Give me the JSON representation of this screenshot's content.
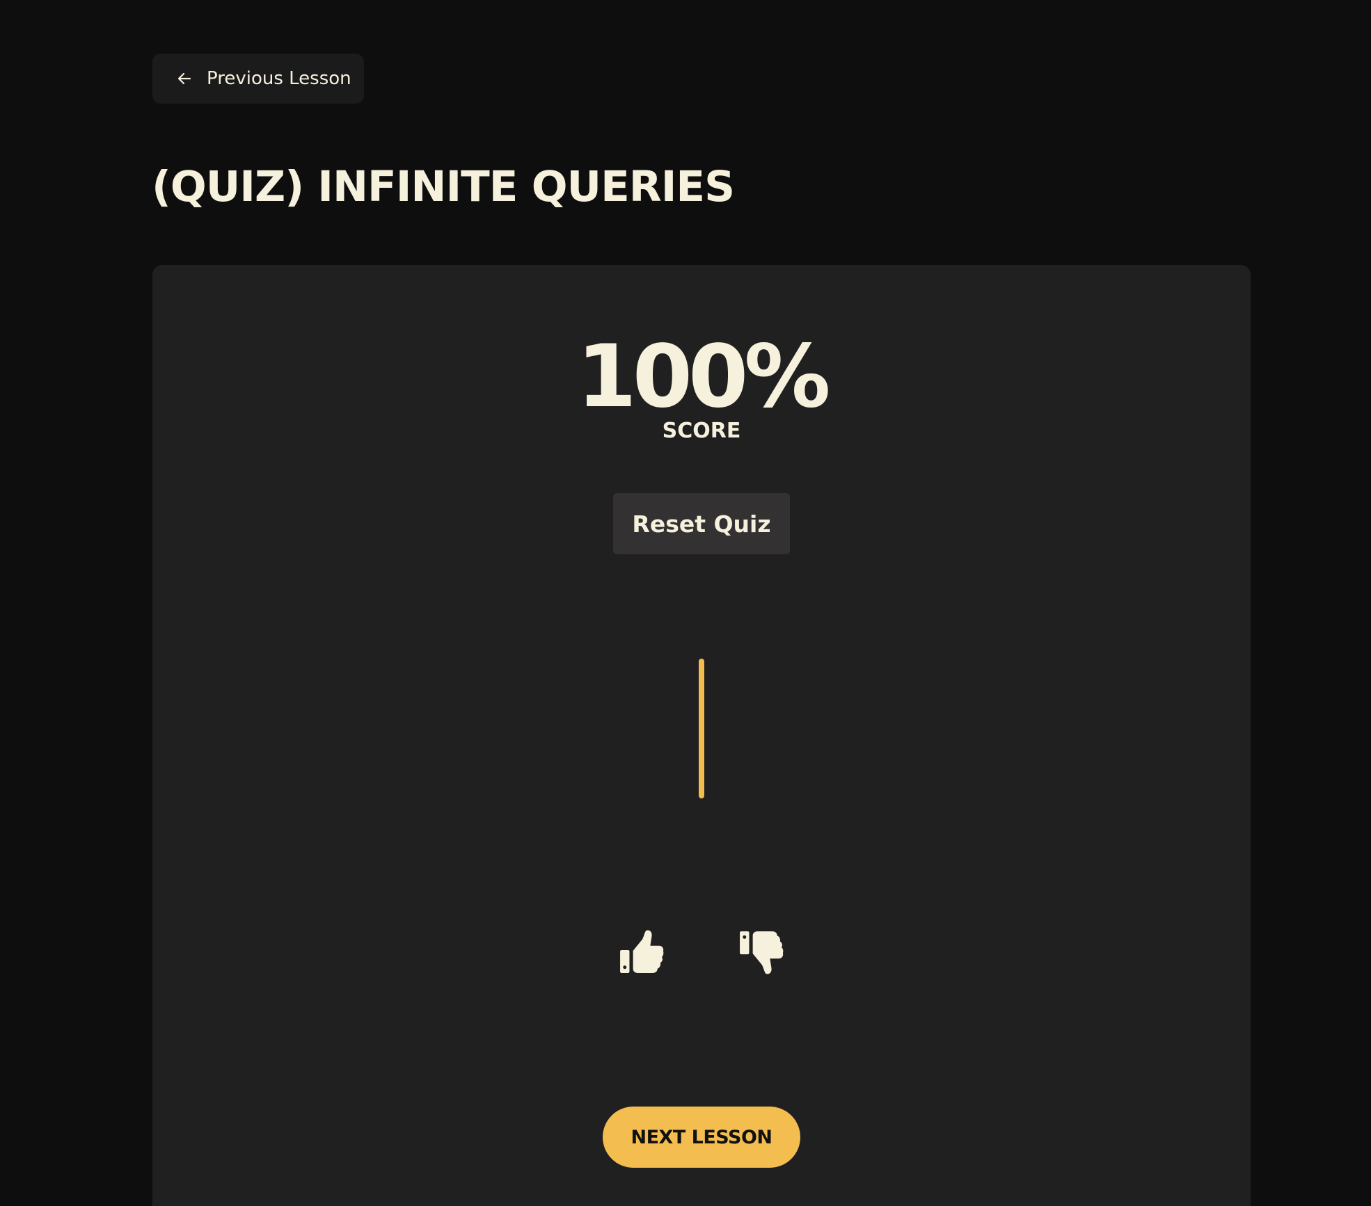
{
  "nav": {
    "previous_label": "Previous Lesson",
    "previous_icon": "arrow-left-icon"
  },
  "page": {
    "title": "(QUIZ) INFINITE QUERIES"
  },
  "quiz": {
    "score_value": "100%",
    "score_label": "SCORE",
    "reset_label": "Reset Quiz"
  },
  "feedback": {
    "like_icon": "thumbs-up-icon",
    "dislike_icon": "thumbs-down-icon"
  },
  "footer": {
    "next_label": "NEXT LESSON"
  },
  "colors": {
    "background": "#0f0e0f",
    "card": "#212021",
    "text": "#f6f1dc",
    "accent": "#f3bd4f",
    "button": "#343132"
  }
}
